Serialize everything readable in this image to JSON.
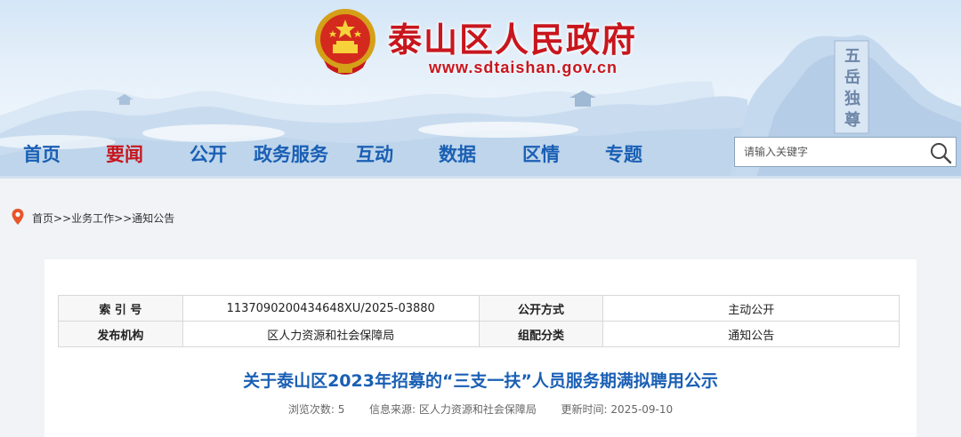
{
  "header": {
    "site_title": "泰山区人民政府",
    "site_url": "www.sdtaishan.gov.cn",
    "calligraphy": "五岳独尊"
  },
  "nav": {
    "items": [
      {
        "label": "首页",
        "active": false
      },
      {
        "label": "要闻",
        "active": true
      },
      {
        "label": "公开",
        "active": false
      },
      {
        "label": "政务服务",
        "active": false
      },
      {
        "label": "互动",
        "active": false
      },
      {
        "label": "数据",
        "active": false
      },
      {
        "label": "区情",
        "active": false
      },
      {
        "label": "专题",
        "active": false
      }
    ],
    "search_placeholder": "请输入关键字"
  },
  "breadcrumb": {
    "home": "首页",
    "sep1": ">>",
    "level1": "业务工作",
    "sep2": ">>",
    "level2": "通知公告"
  },
  "meta": {
    "index_key": "索 引 号",
    "index_value": "1137090200434648XU/2025-03880",
    "mode_key": "公开方式",
    "mode_value": "主动公开",
    "org_key": "发布机构",
    "org_value": "区人力资源和社会保障局",
    "category_key": "组配分类",
    "category_value": "通知公告"
  },
  "article": {
    "title": "关于泰山区2023年招募的“三支一扶”人员服务期满拟聘用公示",
    "views_label": "浏览次数:",
    "views": "5",
    "source_label": "信息来源:",
    "source": "区人力资源和社会保障局",
    "updated_label": "更新时间:",
    "updated": "2025-09-10"
  },
  "colors": {
    "brand_red": "#c8161d",
    "nav_blue": "#1a5fb4"
  }
}
